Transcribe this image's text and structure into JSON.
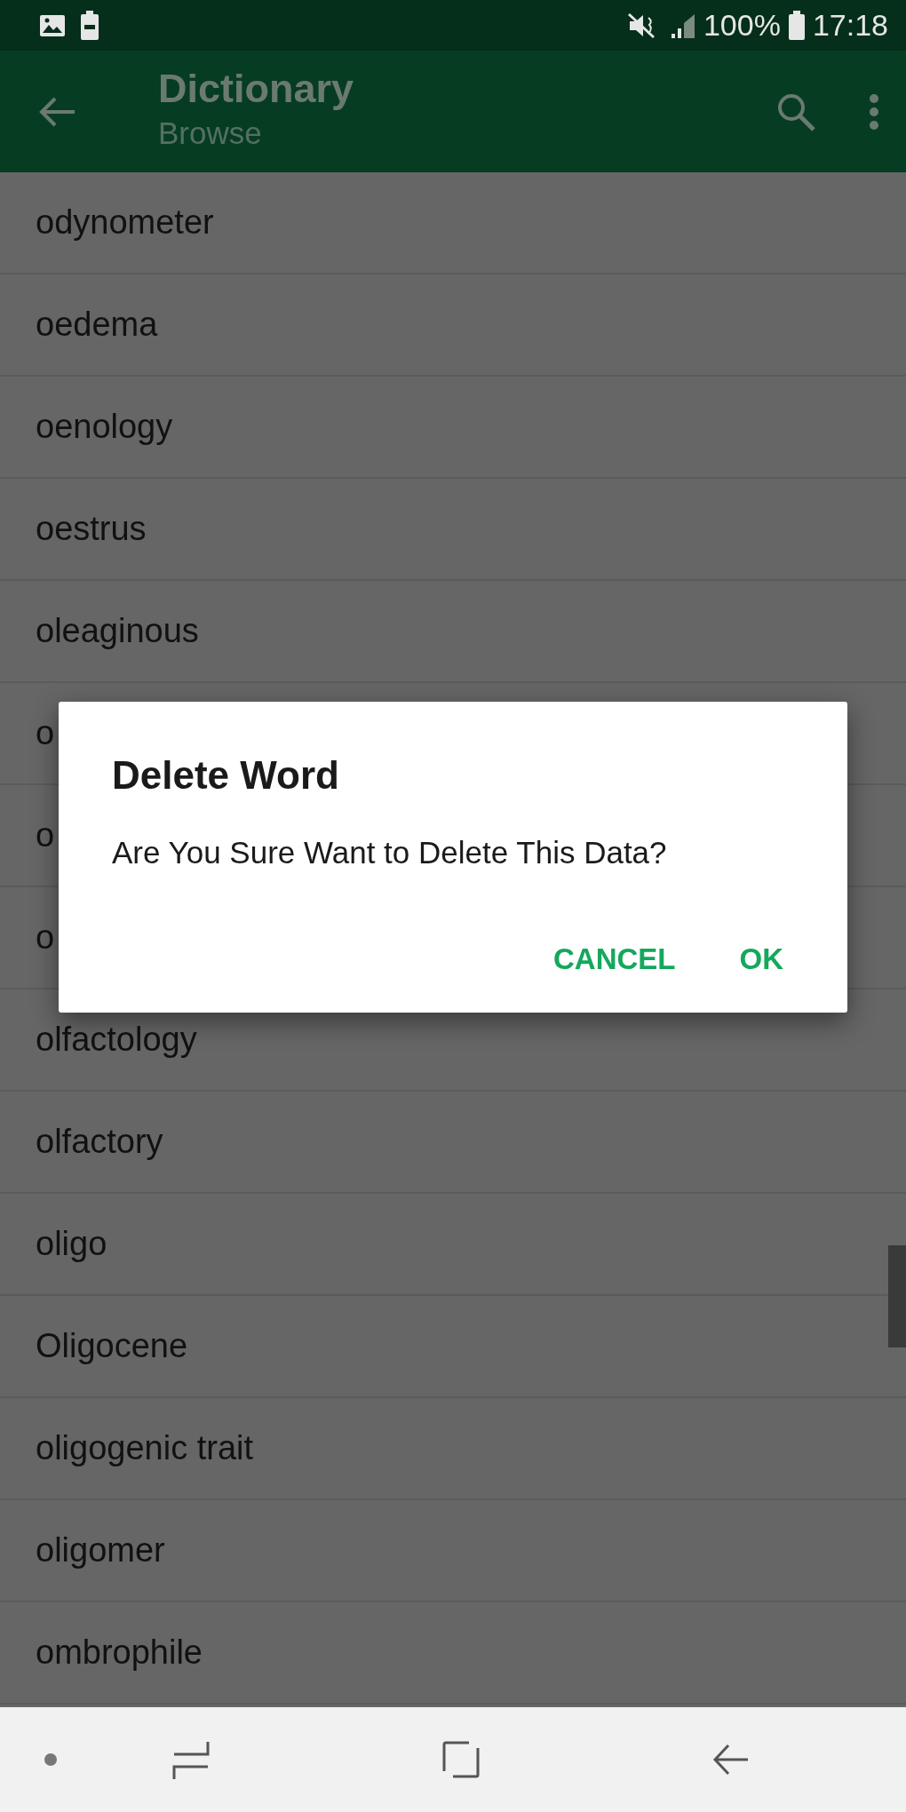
{
  "status_bar": {
    "battery": "100%",
    "time": "17:18"
  },
  "app_bar": {
    "title": "Dictionary",
    "subtitle": "Browse"
  },
  "words": [
    {
      "text": "odynometer"
    },
    {
      "text": "oedema"
    },
    {
      "text": "oenology"
    },
    {
      "text": "oestrus"
    },
    {
      "text": "oleaginous"
    },
    {
      "text": "o"
    },
    {
      "text": "o"
    },
    {
      "text": "o"
    },
    {
      "text": "olfactology"
    },
    {
      "text": "olfactory"
    },
    {
      "text": "oligo"
    },
    {
      "text": "Oligocene"
    },
    {
      "text": "oligogenic trait"
    },
    {
      "text": "oligomer"
    },
    {
      "text": "ombrophile"
    }
  ],
  "dialog": {
    "title": "Delete Word",
    "message": "Are You Sure Want to Delete This Data?",
    "buttons": [
      {
        "label": "CANCEL"
      },
      {
        "label": "OK"
      }
    ]
  }
}
